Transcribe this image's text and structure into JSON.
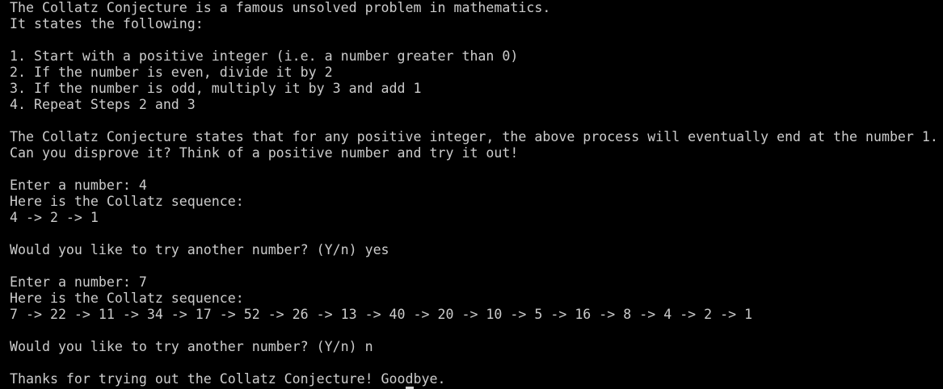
{
  "terminal": {
    "lines": [
      "The Collatz Conjecture is a famous unsolved problem in mathematics.",
      "It states the following:",
      "",
      "1. Start with a positive integer (i.e. a number greater than 0)",
      "2. If the number is even, divide it by 2",
      "3. If the number is odd, multiply it by 3 and add 1",
      "4. Repeat Steps 2 and 3",
      "",
      "The Collatz Conjecture states that for any positive integer, the above process will eventually end at the number 1.",
      "Can you disprove it? Think of a positive number and try it out!",
      "",
      "Enter a number: 4",
      "Here is the Collatz sequence:",
      "4 -> 2 -> 1",
      "",
      "Would you like to try another number? (Y/n) yes",
      "",
      "Enter a number: 7",
      "Here is the Collatz sequence:",
      "7 -> 22 -> 11 -> 34 -> 17 -> 52 -> 26 -> 13 -> 40 -> 20 -> 10 -> 5 -> 16 -> 8 -> 4 -> 2 -> 1",
      "",
      "Would you like to try another number? (Y/n) n",
      "",
      "Thanks for trying out the Collatz Conjecture! Goodbye."
    ],
    "colors": {
      "background": "#000000",
      "foreground": "#cccccc"
    }
  }
}
